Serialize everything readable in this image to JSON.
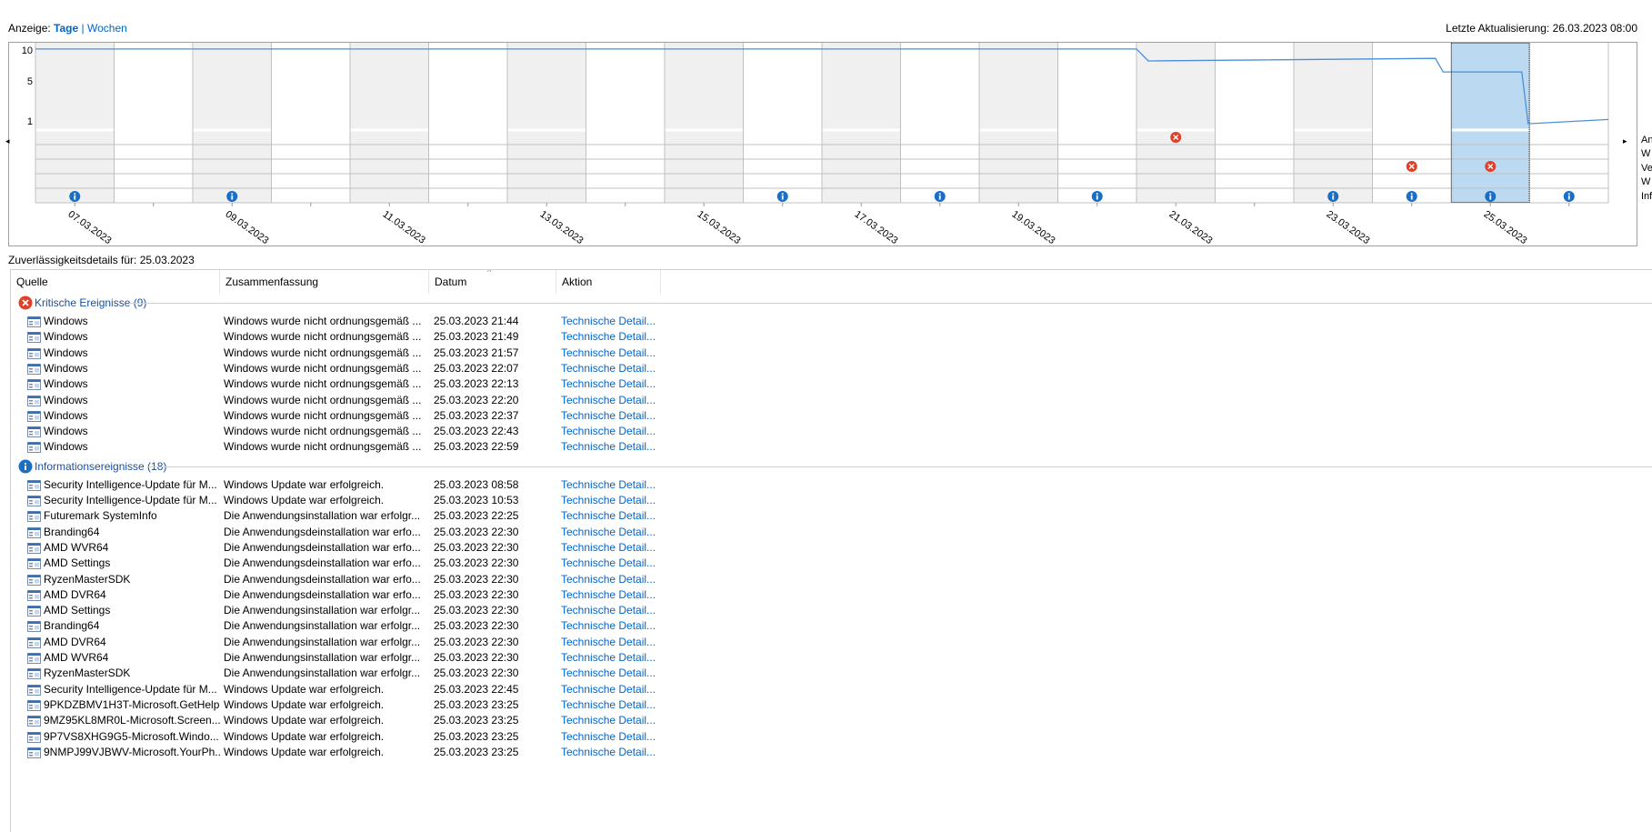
{
  "view": {
    "label": "Anzeige:",
    "days": "Tage",
    "separator": "|",
    "weeks": "Wochen"
  },
  "last_update": "Letzte Aktualisierung: 26.03.2023 08:00",
  "chart": {
    "y_ticks": [
      "10",
      "5",
      "1"
    ],
    "date_labels": [
      "07.03.2023",
      "09.03.2023",
      "11.03.2023",
      "13.03.2023",
      "15.03.2023",
      "17.03.2023",
      "19.03.2023",
      "21.03.2023",
      "23.03.2023",
      "25.03.2023"
    ],
    "row_labels": [
      "An",
      "W",
      "Ve",
      "W",
      "Inf"
    ],
    "selected_day_index": 18,
    "errors": [
      {
        "row": 0,
        "day": 14
      },
      {
        "row": 2,
        "day": 17
      },
      {
        "row": 2,
        "day": 18
      }
    ],
    "infos": [
      0,
      2,
      9,
      11,
      13,
      16,
      17,
      18,
      19
    ],
    "stability": [
      [
        0,
        9.9
      ],
      [
        14,
        9.9
      ],
      [
        14.15,
        8.5
      ],
      [
        17.8,
        8.8
      ],
      [
        17.9,
        7.2
      ],
      [
        18.9,
        7.2
      ],
      [
        18.98,
        1.1
      ],
      [
        20,
        1.6
      ]
    ],
    "colors": {
      "line": "#4a90d9",
      "selected": "#bcd9f2",
      "shade": "#f0f0f0",
      "grid": "#c0c0c0",
      "error": "#e0402a",
      "info": "#1a6fc4"
    }
  },
  "details_title": "Zuverlässigkeitsdetails für: 25.03.2023",
  "table": {
    "columns": [
      "Quelle",
      "Zusammenfassung",
      "Datum",
      "Aktion"
    ],
    "groups": [
      {
        "label": "Kritische Ereignisse (9)",
        "icon": "error-icon",
        "rows": [
          [
            "Windows",
            "Windows wurde nicht ordnungsgemäß ...",
            "25.03.2023 21:44",
            "Technische Detail..."
          ],
          [
            "Windows",
            "Windows wurde nicht ordnungsgemäß ...",
            "25.03.2023 21:49",
            "Technische Detail..."
          ],
          [
            "Windows",
            "Windows wurde nicht ordnungsgemäß ...",
            "25.03.2023 21:57",
            "Technische Detail..."
          ],
          [
            "Windows",
            "Windows wurde nicht ordnungsgemäß ...",
            "25.03.2023 22:07",
            "Technische Detail..."
          ],
          [
            "Windows",
            "Windows wurde nicht ordnungsgemäß ...",
            "25.03.2023 22:13",
            "Technische Detail..."
          ],
          [
            "Windows",
            "Windows wurde nicht ordnungsgemäß ...",
            "25.03.2023 22:20",
            "Technische Detail..."
          ],
          [
            "Windows",
            "Windows wurde nicht ordnungsgemäß ...",
            "25.03.2023 22:37",
            "Technische Detail..."
          ],
          [
            "Windows",
            "Windows wurde nicht ordnungsgemäß ...",
            "25.03.2023 22:43",
            "Technische Detail..."
          ],
          [
            "Windows",
            "Windows wurde nicht ordnungsgemäß ...",
            "25.03.2023 22:59",
            "Technische Detail..."
          ]
        ]
      },
      {
        "label": "Informationsereignisse (18)",
        "icon": "info-icon",
        "rows": [
          [
            "Security Intelligence-Update für M...",
            "Windows Update war erfolgreich.",
            "25.03.2023 08:58",
            "Technische Detail..."
          ],
          [
            "Security Intelligence-Update für M...",
            "Windows Update war erfolgreich.",
            "25.03.2023 10:53",
            "Technische Detail..."
          ],
          [
            "Futuremark SystemInfo",
            "Die Anwendungsinstallation war erfolgr...",
            "25.03.2023 22:25",
            "Technische Detail..."
          ],
          [
            "Branding64",
            "Die Anwendungsdeinstallation war erfo...",
            "25.03.2023 22:30",
            "Technische Detail..."
          ],
          [
            "AMD WVR64",
            "Die Anwendungsdeinstallation war erfo...",
            "25.03.2023 22:30",
            "Technische Detail..."
          ],
          [
            "AMD Settings",
            "Die Anwendungsdeinstallation war erfo...",
            "25.03.2023 22:30",
            "Technische Detail..."
          ],
          [
            "RyzenMasterSDK",
            "Die Anwendungsdeinstallation war erfo...",
            "25.03.2023 22:30",
            "Technische Detail..."
          ],
          [
            "AMD DVR64",
            "Die Anwendungsdeinstallation war erfo...",
            "25.03.2023 22:30",
            "Technische Detail..."
          ],
          [
            "AMD Settings",
            "Die Anwendungsinstallation war erfolgr...",
            "25.03.2023 22:30",
            "Technische Detail..."
          ],
          [
            "Branding64",
            "Die Anwendungsinstallation war erfolgr...",
            "25.03.2023 22:30",
            "Technische Detail..."
          ],
          [
            "AMD DVR64",
            "Die Anwendungsinstallation war erfolgr...",
            "25.03.2023 22:30",
            "Technische Detail..."
          ],
          [
            "AMD WVR64",
            "Die Anwendungsinstallation war erfolgr...",
            "25.03.2023 22:30",
            "Technische Detail..."
          ],
          [
            "RyzenMasterSDK",
            "Die Anwendungsinstallation war erfolgr...",
            "25.03.2023 22:30",
            "Technische Detail..."
          ],
          [
            "Security Intelligence-Update für M...",
            "Windows Update war erfolgreich.",
            "25.03.2023 22:45",
            "Technische Detail..."
          ],
          [
            "9PKDZBMV1H3T-Microsoft.GetHelp",
            "Windows Update war erfolgreich.",
            "25.03.2023 23:25",
            "Technische Detail..."
          ],
          [
            "9MZ95KL8MR0L-Microsoft.Screen...",
            "Windows Update war erfolgreich.",
            "25.03.2023 23:25",
            "Technische Detail..."
          ],
          [
            "9P7VS8XHG9G5-Microsoft.Windo...",
            "Windows Update war erfolgreich.",
            "25.03.2023 23:25",
            "Technische Detail..."
          ],
          [
            "9NMPJ99VJBWV-Microsoft.YourPh...",
            "Windows Update war erfolgreich.",
            "25.03.2023 23:25",
            "Technische Detail..."
          ]
        ]
      }
    ]
  }
}
